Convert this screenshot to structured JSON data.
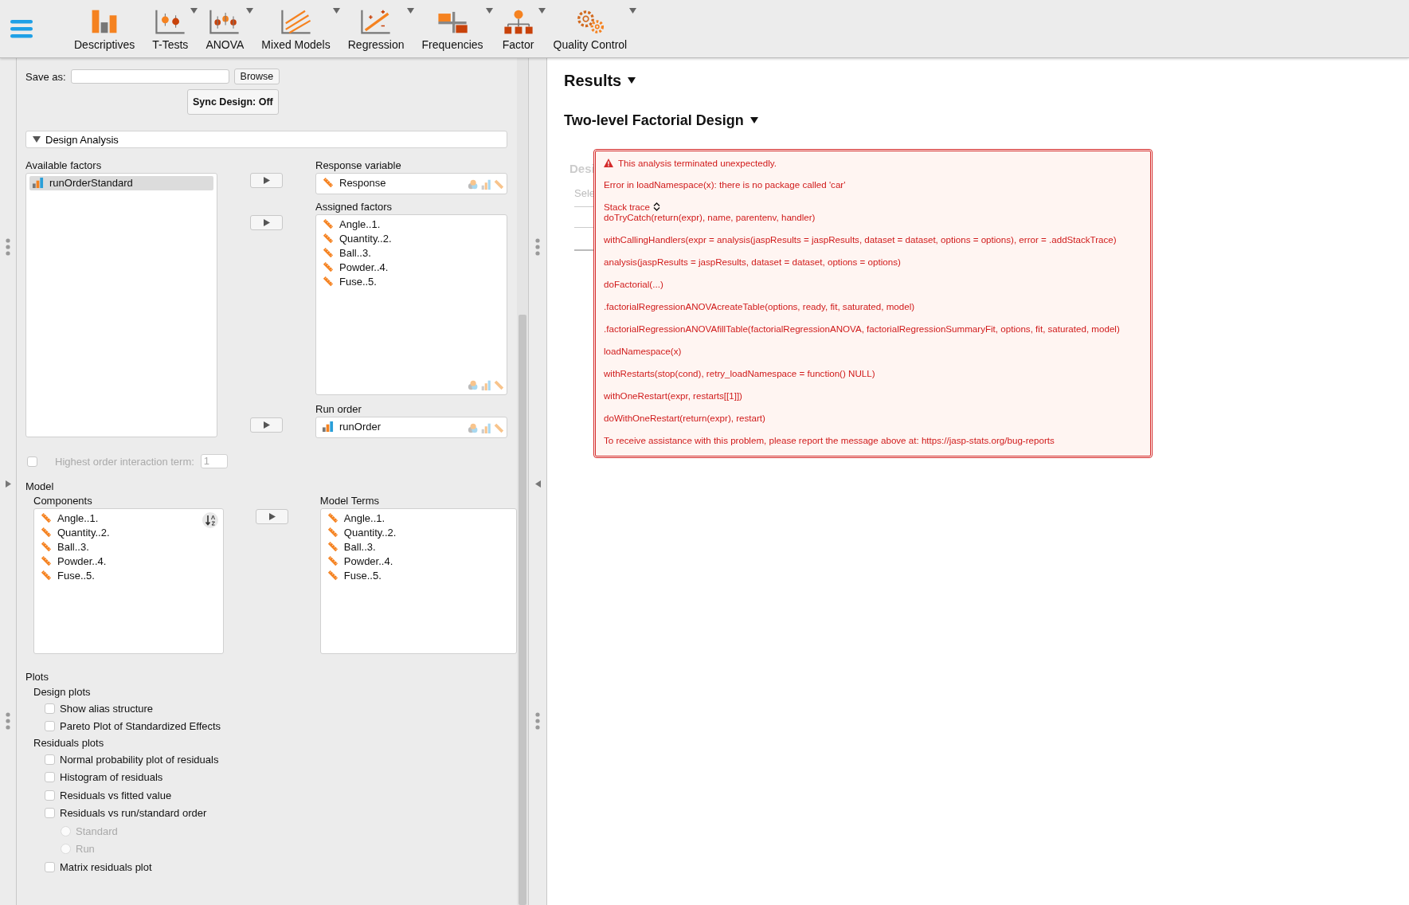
{
  "toolbar": {
    "items": [
      {
        "label": "Descriptives",
        "dropdown": false
      },
      {
        "label": "T-Tests",
        "dropdown": true
      },
      {
        "label": "ANOVA",
        "dropdown": true
      },
      {
        "label": "Mixed Models",
        "dropdown": true
      },
      {
        "label": "Regression",
        "dropdown": true
      },
      {
        "label": "Frequencies",
        "dropdown": true
      },
      {
        "label": "Factor",
        "dropdown": true
      },
      {
        "label": "Quality Control",
        "dropdown": true
      }
    ]
  },
  "options": {
    "save_as": {
      "label": "Save as:",
      "browse": "Browse"
    },
    "sync_button": "Sync Design: Off",
    "design_analysis": {
      "title": "Design Analysis",
      "expanded": true
    },
    "available_factors": {
      "label": "Available factors",
      "items": [
        {
          "name": "runOrderStandard",
          "kind": "ordinal",
          "selected": true
        }
      ]
    },
    "response_variable": {
      "label": "Response variable",
      "items": [
        {
          "name": "Response",
          "kind": "scale",
          "selected": false
        }
      ]
    },
    "assigned_factors": {
      "label": "Assigned factors",
      "items": [
        {
          "name": "Angle..1.",
          "kind": "scale",
          "selected": false
        },
        {
          "name": "Quantity..2.",
          "kind": "scale",
          "selected": false
        },
        {
          "name": "Ball..3.",
          "kind": "scale",
          "selected": false
        },
        {
          "name": "Powder..4.",
          "kind": "scale",
          "selected": false
        },
        {
          "name": "Fuse..5.",
          "kind": "scale",
          "selected": false
        }
      ]
    },
    "run_order": {
      "label": "Run order",
      "items": [
        {
          "name": "runOrder",
          "kind": "ordinal",
          "selected": false
        }
      ]
    },
    "highest_order": {
      "label": "Highest order interaction term:",
      "value": "1",
      "checked": false,
      "disabled": true
    },
    "model": {
      "title": "Model",
      "components": {
        "label": "Components",
        "items": [
          {
            "name": "Angle..1.",
            "kind": "scale",
            "selected": false
          },
          {
            "name": "Quantity..2.",
            "kind": "scale",
            "selected": false
          },
          {
            "name": "Ball..3.",
            "kind": "scale",
            "selected": false
          },
          {
            "name": "Powder..4.",
            "kind": "scale",
            "selected": false
          },
          {
            "name": "Fuse..5.",
            "kind": "scale",
            "selected": false
          }
        ]
      },
      "model_terms": {
        "label": "Model Terms",
        "items": [
          {
            "name": "Angle..1.",
            "kind": "scale",
            "selected": false
          },
          {
            "name": "Quantity..2.",
            "kind": "scale",
            "selected": false
          },
          {
            "name": "Ball..3.",
            "kind": "scale",
            "selected": false
          },
          {
            "name": "Powder..4.",
            "kind": "scale",
            "selected": false
          },
          {
            "name": "Fuse..5.",
            "kind": "scale",
            "selected": false
          }
        ]
      }
    },
    "plots": {
      "title": "Plots",
      "groups": [
        {
          "title": "Design plots",
          "options": [
            {
              "kind": "checkbox",
              "label": "Show alias structure",
              "checked": false,
              "disabled": false
            },
            {
              "kind": "checkbox",
              "label": "Pareto Plot of Standardized Effects",
              "checked": false,
              "disabled": false
            }
          ]
        },
        {
          "title": "Residuals plots",
          "options": [
            {
              "kind": "checkbox",
              "label": "Normal probability plot of residuals",
              "checked": false,
              "disabled": false
            },
            {
              "kind": "checkbox",
              "label": "Histogram of residuals",
              "checked": false,
              "disabled": false
            },
            {
              "kind": "checkbox",
              "label": "Residuals vs fitted value",
              "checked": false,
              "disabled": false
            },
            {
              "kind": "checkbox",
              "label": "Residuals vs run/standard order",
              "checked": false,
              "disabled": false
            },
            {
              "kind": "radio",
              "label": "Standard",
              "selected": false,
              "disabled": true
            },
            {
              "kind": "radio",
              "label": "Run",
              "selected": false,
              "disabled": true
            },
            {
              "kind": "checkbox",
              "label": "Matrix residuals plot",
              "checked": false,
              "disabled": false
            }
          ]
        }
      ]
    }
  },
  "results": {
    "title": "Results",
    "analysis_title": "Two-level Factorial Design",
    "hidden_fragments": [
      "Desi",
      "Sele"
    ],
    "error": {
      "headline": "This analysis terminated unexpectedly.",
      "message": "Error in loadNamespace(x): there is no package called 'car'",
      "stack_label": "Stack trace",
      "stack": [
        "doTryCatch(return(expr), name, parentenv, handler)",
        "withCallingHandlers(expr = analysis(jaspResults = jaspResults, dataset = dataset, options = options), error = .addStackTrace)",
        "analysis(jaspResults = jaspResults, dataset = dataset, options = options)",
        "doFactorial(...)",
        ".factorialRegressionANOVAcreateTable(options, ready, fit, saturated, model)",
        ".factorialRegressionANOVAfillTable(factorialRegressionANOVA, factorialRegressionSummaryFit, options, fit, saturated, model)",
        "loadNamespace(x)",
        "withRestarts(stop(cond), retry_loadNamespace = function() NULL)",
        "withOneRestart(expr, restarts[[1]])",
        "doWithOneRestart(return(expr), restart)"
      ],
      "footer": "To receive assistance with this problem, please report the message above at: https://jasp-stats.org/bug-reports"
    }
  }
}
